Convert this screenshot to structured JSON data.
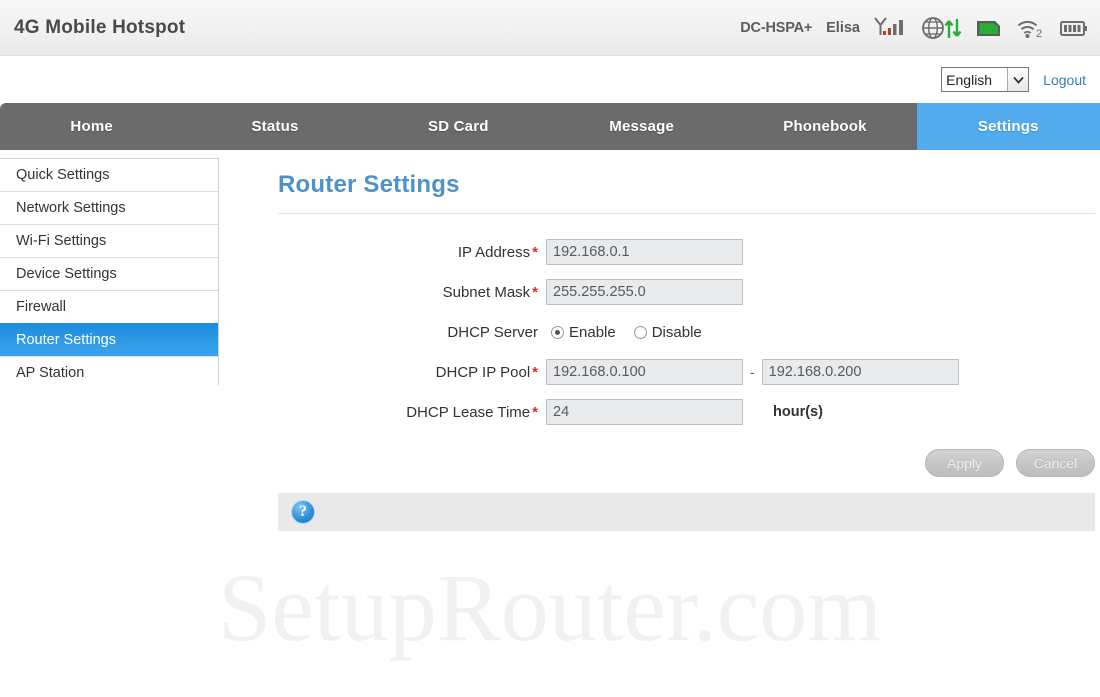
{
  "header": {
    "brand": "4G Mobile Hotspot",
    "network_type": "DC-HSPA+",
    "carrier": "Elisa",
    "icons": [
      "signal-strength-icon",
      "globe-data-transfer-icon",
      "sim-card-icon",
      "wifi-clients-icon",
      "battery-icon"
    ],
    "wifi_client_count": "2"
  },
  "toolbar": {
    "language_value": "English",
    "language_options": [
      "English"
    ],
    "logout_label": "Logout"
  },
  "nav": {
    "items": [
      {
        "label": "Home",
        "active": false
      },
      {
        "label": "Status",
        "active": false
      },
      {
        "label": "SD Card",
        "active": false
      },
      {
        "label": "Message",
        "active": false
      },
      {
        "label": "Phonebook",
        "active": false
      },
      {
        "label": "Settings",
        "active": true
      }
    ],
    "active_color": "#52ABEC",
    "bar_color": "#6b6b6b"
  },
  "sidebar": {
    "items": [
      {
        "label": "Quick Settings",
        "active": false
      },
      {
        "label": "Network Settings",
        "active": false
      },
      {
        "label": "Wi-Fi Settings",
        "active": false
      },
      {
        "label": "Device Settings",
        "active": false
      },
      {
        "label": "Firewall",
        "active": false
      },
      {
        "label": "Router Settings",
        "active": true
      },
      {
        "label": "AP Station",
        "active": false
      }
    ],
    "active_color": "#1b8ddd"
  },
  "main": {
    "title": "Router Settings",
    "title_color": "#4d93c9",
    "form": {
      "ip_address": {
        "label": "IP Address",
        "required": "*",
        "value": "192.168.0.1"
      },
      "subnet_mask": {
        "label": "Subnet Mask",
        "required": "*",
        "value": "255.255.255.0"
      },
      "dhcp_server": {
        "label": "DHCP Server",
        "options": [
          {
            "label": "Enable",
            "selected": true
          },
          {
            "label": "Disable",
            "selected": false
          }
        ]
      },
      "dhcp_ip_pool": {
        "label": "DHCP IP Pool",
        "required": "*",
        "start": "192.168.0.100",
        "separator": "-",
        "end": "192.168.0.200"
      },
      "dhcp_lease_time": {
        "label": "DHCP Lease Time",
        "required": "*",
        "value": "24",
        "unit": "hour(s)"
      }
    },
    "buttons": {
      "apply_label": "Apply",
      "cancel_label": "Cancel"
    },
    "help": {
      "icon": "help-question-icon",
      "text": ""
    }
  },
  "watermark": {
    "text": "SetupRouter.com"
  }
}
